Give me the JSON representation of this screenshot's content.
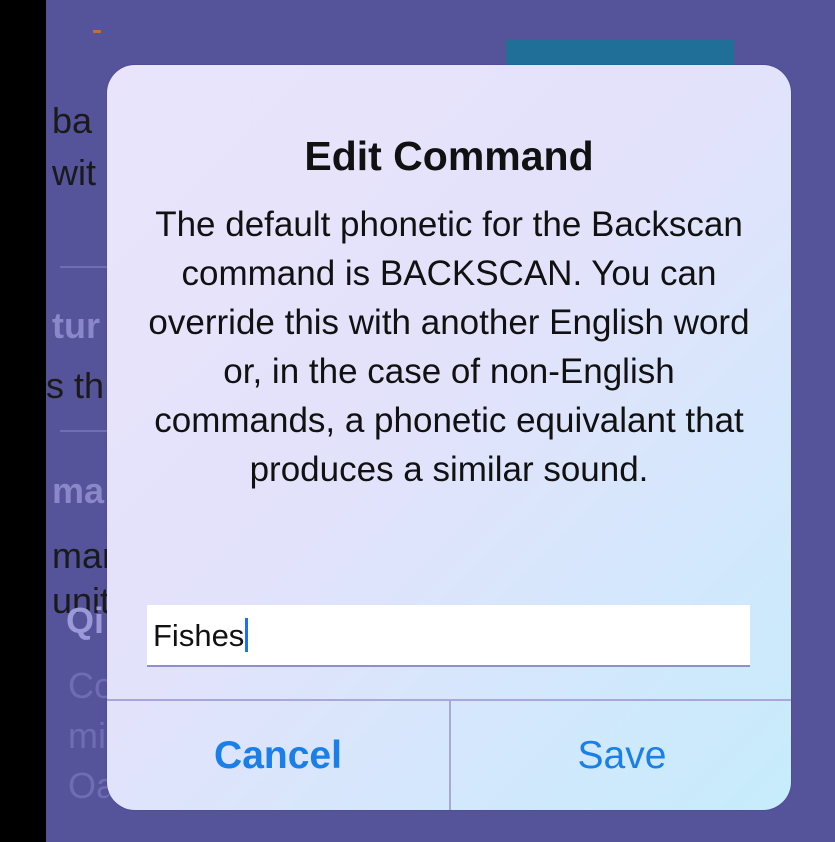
{
  "background": {
    "fragments": [
      "ba",
      "wit",
      "tur",
      "s th",
      "ma",
      "mar",
      "unit",
      "Qi",
      "Co",
      "mi",
      "Oa"
    ]
  },
  "dialog": {
    "title": "Edit Command",
    "message": "The default phonetic for the Backscan command is BACKSCAN. You can override this with another English word or, in the case of non-English commands, a phonetic equivalant that produces a similar sound.",
    "input_value": "Fishes",
    "cancel_label": "Cancel",
    "save_label": "Save"
  },
  "colors": {
    "accent": "#1a7fe8",
    "background": "#55539a"
  }
}
